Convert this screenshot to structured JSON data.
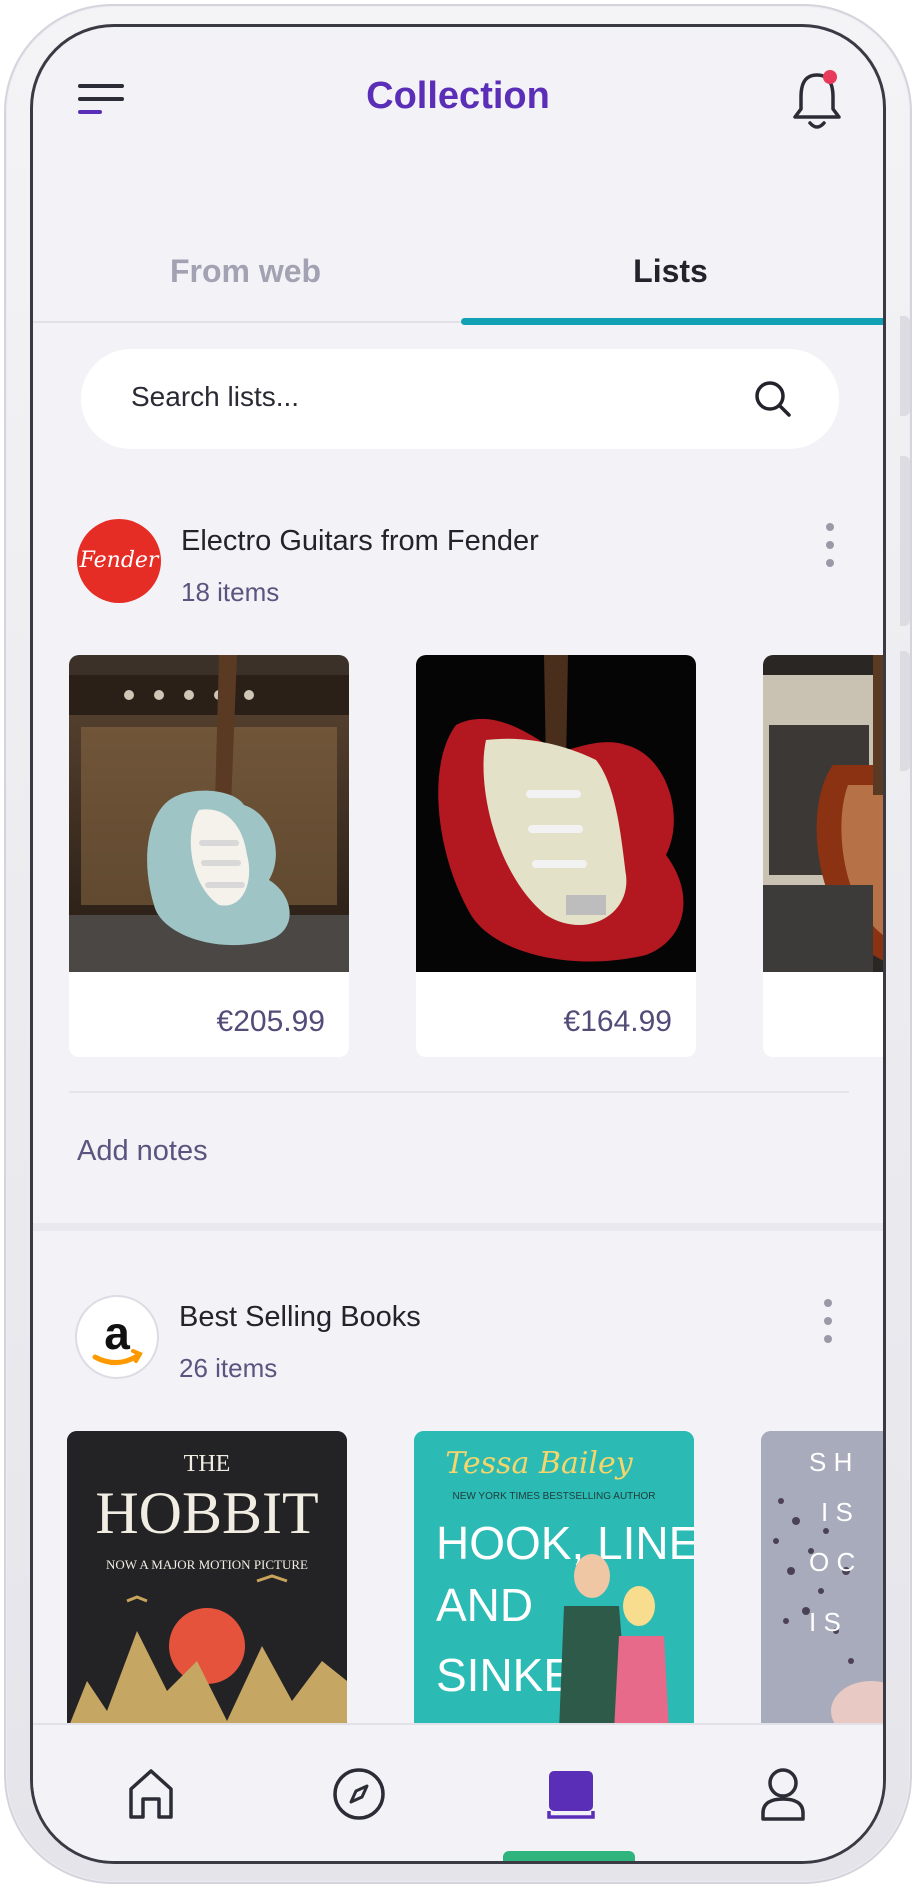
{
  "header": {
    "title": "Collection"
  },
  "tabs": [
    {
      "label": "From web",
      "active": false
    },
    {
      "label": "Lists",
      "active": true
    }
  ],
  "search": {
    "placeholder": "Search lists..."
  },
  "lists": [
    {
      "name": "Electro Guitars from Fender",
      "count": "18 items",
      "logo_text": "Fender",
      "items": [
        {
          "image": "sonic-blue-stratocaster-photo",
          "price": "€205.99"
        },
        {
          "image": "candy-apple-red-stratocaster-photo",
          "price": "€164.99"
        },
        {
          "image": "sunburst-jazzmaster-photo",
          "price": ""
        }
      ],
      "add_notes": "Add notes"
    },
    {
      "name": "Best Selling Books",
      "count": "26 items",
      "logo_text": "a",
      "items": [
        {
          "image": "the-hobbit-cover",
          "cover_title": "THE HOBBIT",
          "cover_subtitle": "NOW A MAJOR MOTION PICTURE"
        },
        {
          "image": "hook-line-and-sinker-cover",
          "cover_author": "Tessa Bailey",
          "cover_tagline": "NEW YORK TIMES BESTSELLING AUTHOR",
          "cover_title": "HOOK, LINE, AND SINKER"
        },
        {
          "image": "third-book-cover",
          "cover_letters": "S H I S O C I S"
        }
      ]
    }
  ],
  "bottom_nav": [
    {
      "icon": "home-icon",
      "active": false
    },
    {
      "icon": "compass-icon",
      "active": false
    },
    {
      "icon": "book-icon",
      "active": true
    },
    {
      "icon": "user-icon",
      "active": false
    }
  ],
  "colors": {
    "accent": "#5b2eb8",
    "tab_indicator": "#12a1b4",
    "notification_dot": "#e83a5a",
    "fender_red": "#e52d26",
    "home_indicator": "#2fb47e"
  }
}
